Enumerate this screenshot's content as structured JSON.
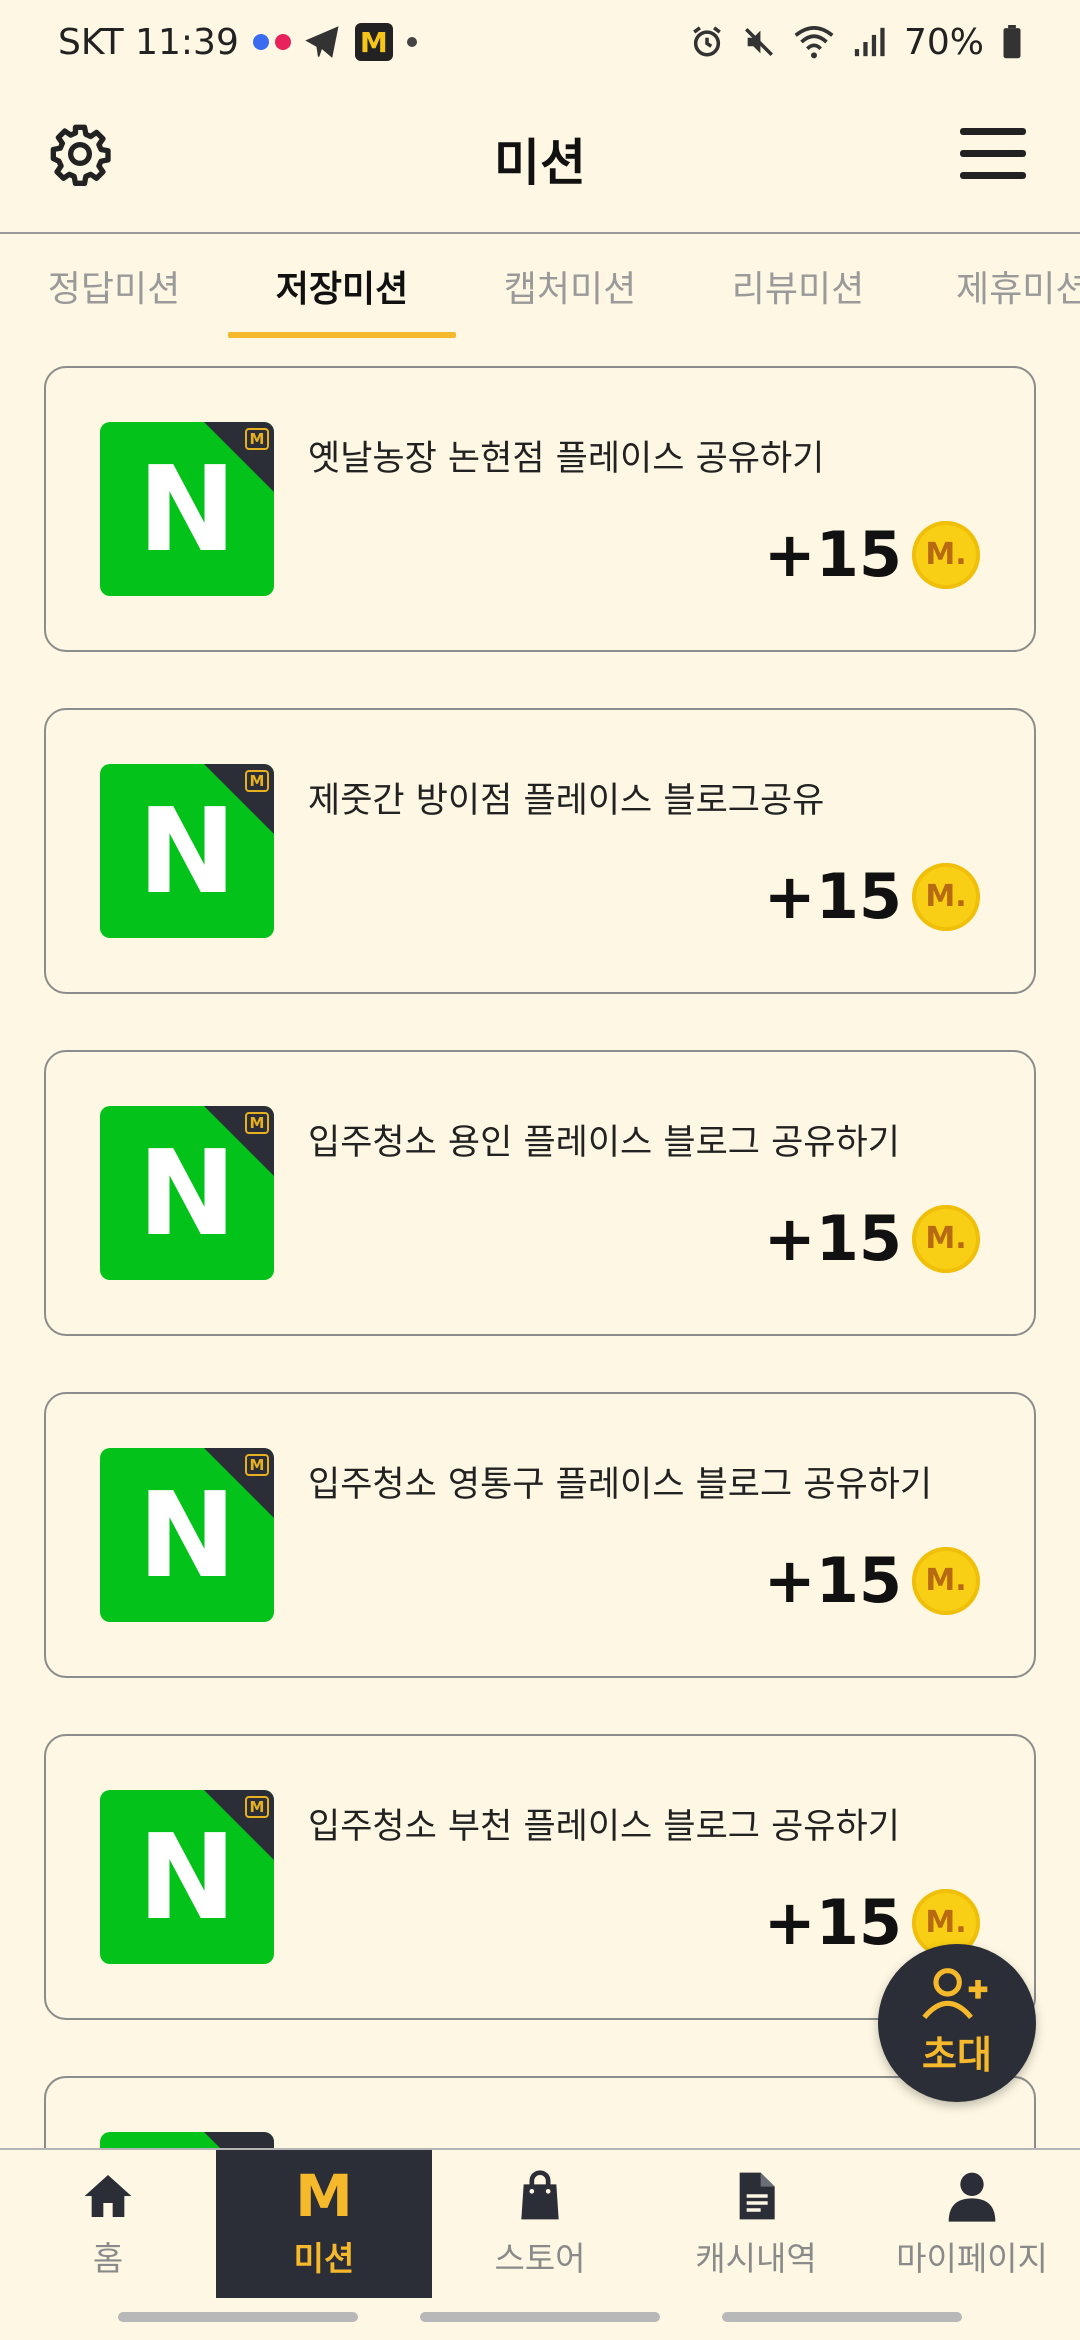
{
  "status_bar": {
    "carrier_time": "SKT 11:39",
    "battery": "70%",
    "app_badge": "M"
  },
  "header": {
    "title": "미션"
  },
  "tabs": [
    {
      "label": "정답미션",
      "active": false
    },
    {
      "label": "저장미션",
      "active": true
    },
    {
      "label": "캡처미션",
      "active": false
    },
    {
      "label": "리뷰미션",
      "active": false
    },
    {
      "label": "제휴미션",
      "active": false
    }
  ],
  "missions": [
    {
      "title": "옛날농장 논현점 플레이스 공유하기",
      "reward": "+15",
      "thumb_letter": "N",
      "badge": "M",
      "coin": "M."
    },
    {
      "title": "제줏간 방이점 플레이스 블로그공유",
      "reward": "+15",
      "thumb_letter": "N",
      "badge": "M",
      "coin": "M."
    },
    {
      "title": "입주청소 용인 플레이스 블로그 공유하기",
      "reward": "+15",
      "thumb_letter": "N",
      "badge": "M",
      "coin": "M."
    },
    {
      "title": "입주청소 영통구 플레이스 블로그 공유하기",
      "reward": "+15",
      "thumb_letter": "N",
      "badge": "M",
      "coin": "M."
    },
    {
      "title": "입주청소 부천 플레이스 블로그 공유하기",
      "reward": "+15",
      "thumb_letter": "N",
      "badge": "M",
      "coin": "M."
    }
  ],
  "fab": {
    "label": "초대"
  },
  "bottom_nav": [
    {
      "label": "홈",
      "icon": "home-icon"
    },
    {
      "label": "미션",
      "icon": "m-logo-icon",
      "glyph": "M"
    },
    {
      "label": "스토어",
      "icon": "shopping-bag-icon"
    },
    {
      "label": "캐시내역",
      "icon": "document-icon"
    },
    {
      "label": "마이페이지",
      "icon": "person-icon"
    }
  ],
  "colors": {
    "background": "#fdf7e3",
    "accent": "#f5b92b",
    "dark": "#2b2e36",
    "naver_green": "#03c21a",
    "coin": "#f8cf14"
  }
}
